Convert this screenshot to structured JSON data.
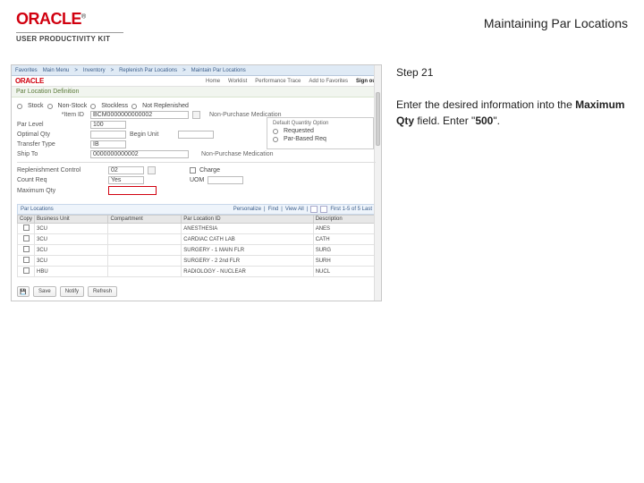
{
  "header": {
    "brand_text": "ORACLE",
    "brand_tm": "®",
    "subbrand": "USER PRODUCTIVITY KIT",
    "title": "Maintaining Par Locations"
  },
  "instruction": {
    "step_label": "Step 21",
    "text_before": "Enter the desired information into the ",
    "bold1": "Maximum Qty",
    "text_mid": " field. Enter \"",
    "bold2": "500",
    "text_after": "\"."
  },
  "mock": {
    "breadcrumb": [
      "Favorites",
      "Main Menu",
      "Inventory",
      "Replenish Par Locations",
      "Maintain Par Locations"
    ],
    "brand": "ORACLE",
    "nav": [
      "Home",
      "Worklist",
      "Performance Trace",
      "Add to Favorites",
      "Sign out"
    ],
    "page_title": "Par Location Definition",
    "radios": [
      "Stock",
      "Non-Stock",
      "Stockless",
      "Not Replenished"
    ],
    "form": {
      "item_id": {
        "label": "*Item ID",
        "value": "BCM0000000000002",
        "desc": "Non-Purchase Medication"
      },
      "par_level": {
        "label": "Par Level",
        "value": "100"
      },
      "opt_qty": {
        "label": "Optimal Qty",
        "value": ""
      },
      "begin_unit": {
        "label": "Begin Unit",
        "value": ""
      },
      "transfer_type": {
        "label": "Transfer Type",
        "value": "IB"
      },
      "ship_to": {
        "label": "Ship To",
        "value": "0000000000002"
      },
      "non_pur_med": "Non-Purchase Medication",
      "repl_ctrl": {
        "label": "Replenishment Control",
        "value": "02"
      },
      "count_req": {
        "label": "Count Req",
        "value": "Yes"
      },
      "max_qty": {
        "label": "Maximum Qty",
        "value": ""
      },
      "charge": {
        "label": "Charge",
        "value": ""
      },
      "uom": {
        "label": "UOM",
        "value": ""
      },
      "default_option": {
        "legend": "Default Quantity Option",
        "opt1": "Requested",
        "opt2": "Par-Based Req"
      }
    },
    "grid": {
      "title": "Par Locations",
      "tools": {
        "personalize": "Personalize",
        "find": "Find",
        "view": "View All",
        "page": "First 1-5 of 5 Last"
      },
      "headers": [
        "Copy",
        "Business Unit",
        "Compartment",
        "Par Location ID",
        "Description"
      ],
      "rows": [
        {
          "copy": false,
          "bu": "3CU",
          "comp": "",
          "loc": "ANESTHESIA",
          "desc": "ANES"
        },
        {
          "copy": false,
          "bu": "3CU",
          "comp": "",
          "loc": "CARDIAC CATH LAB",
          "desc": "CATH"
        },
        {
          "copy": false,
          "bu": "3CU",
          "comp": "",
          "loc": "SURGERY - 1 MAIN FLR",
          "desc": "SURG"
        },
        {
          "copy": false,
          "bu": "3CU",
          "comp": "",
          "loc": "SURGERY - 2 2nd FLR",
          "desc": "SURH"
        },
        {
          "copy": false,
          "bu": "HBU",
          "comp": "",
          "loc": "RADIOLOGY - NUCLEAR",
          "desc": "NUCL"
        }
      ]
    },
    "footer": {
      "save": "Save",
      "notify": "Notify",
      "refresh": "Refresh"
    }
  }
}
